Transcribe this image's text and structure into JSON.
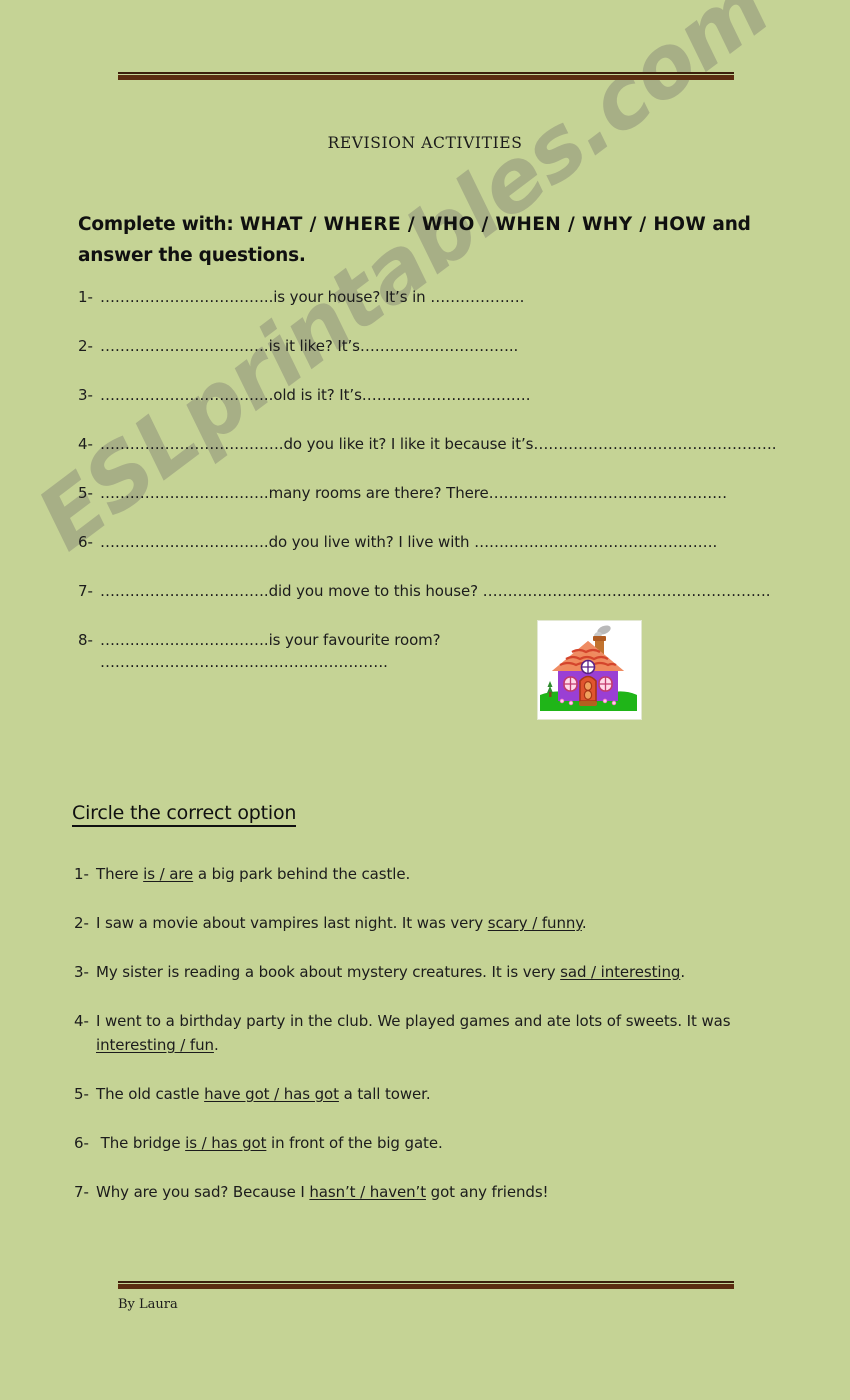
{
  "document": {
    "title": "REVISION ACTIVITIES",
    "background_color": "#c5d395",
    "rule_color": "#5b2d10",
    "watermark": "ESLprintables.com",
    "credit": "By Laura"
  },
  "section1": {
    "instruction_lead": "Complete with:",
    "instruction_wh": "WHAT / WHERE / WHO / WHEN / WHY / HOW",
    "instruction_tail": "and answer the questions.",
    "questions": [
      {
        "number": "1-",
        "text": "……………………………..is  your house?     It’s in ………………."
      },
      {
        "number": "2-",
        "text": "…………………………….is it like?  It’s………………………….."
      },
      {
        "number": "3-",
        "text": "……………………………..old is it?  It’s……………………………."
      },
      {
        "number": "4-",
        "text": "……………………………….do you like it?     I like it because it’s…………………………………………."
      },
      {
        "number": "5-",
        "text": "…………………………….many rooms are there?   There…………………………………………"
      },
      {
        "number": "6-",
        "text": "…………………………….do you live with?   I live with …………………………………………."
      },
      {
        "number": "7-",
        "text": "…………………………….did you move to this house? …………………………………………………."
      },
      {
        "number": "8-",
        "text": "…………………………….is your favourite room?",
        "continuation": "…………………………………………………."
      }
    ],
    "figure_alt": "cartoon-house"
  },
  "section2": {
    "instruction": "Circle the correct option",
    "items": [
      {
        "number": "1-",
        "before": "There ",
        "option": "is  / are",
        "after": " a big park behind the castle."
      },
      {
        "number": "2-",
        "before": "I saw a movie about vampires last night. It was very ",
        "option": "scary / funny",
        "after": "."
      },
      {
        "number": "3-",
        "before": "My sister is reading a book about mystery creatures. It is very ",
        "option": "sad / interesting",
        "after": "."
      },
      {
        "number": "4-",
        "before": "I went to a birthday party in the club. We played games and ate lots of sweets. It was",
        "option": "interesting / fun",
        "after": ".",
        "wrap": true
      },
      {
        "number": "5-",
        "before": "The old castle  ",
        "option": "have got / has got",
        "after": " a tall tower."
      },
      {
        "number": "6-",
        "before": " The bridge ",
        "option": "is /  has got",
        "after": " in front of the big gate."
      },
      {
        "number": "7-",
        "before": "Why are you sad? Because I ",
        "option": "hasn’t / haven’t",
        "after": " got any friends!"
      }
    ]
  }
}
